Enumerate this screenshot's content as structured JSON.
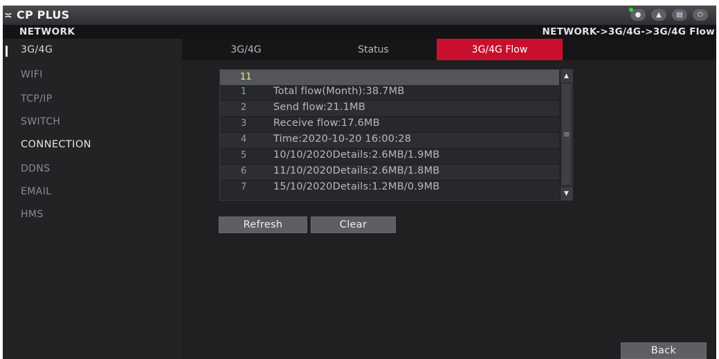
{
  "header": {
    "logo_mark": "≍",
    "logo_text": "CP PLUS",
    "icons": [
      {
        "name": "camera-icon",
        "glyph": "●"
      },
      {
        "name": "user-icon",
        "glyph": "▲"
      },
      {
        "name": "menu-icon",
        "glyph": "▤"
      },
      {
        "name": "power-icon",
        "glyph": "⏻"
      }
    ],
    "status_dot_color": "#38d23c"
  },
  "path": {
    "section": "NETWORK",
    "breadcrumb": "NETWORK->3G/4G->3G/4G Flow"
  },
  "sidebar": {
    "items": [
      {
        "label": "3G/4G",
        "state": "active"
      },
      {
        "label": "WIFI"
      },
      {
        "label": "TCP/IP"
      },
      {
        "label": "SWITCH"
      },
      {
        "label": "CONNECTION"
      },
      {
        "label": "DDNS"
      },
      {
        "label": "EMAIL"
      },
      {
        "label": "HMS"
      }
    ]
  },
  "tabs": [
    {
      "label": "3G/4G"
    },
    {
      "label": "Status"
    },
    {
      "label": "3G/4G Flow",
      "active": true
    }
  ],
  "flow_list": {
    "header": "11",
    "rows": [
      {
        "num": "1",
        "text": "Total flow(Month):38.7MB"
      },
      {
        "num": "2",
        "text": "Send flow:21.1MB"
      },
      {
        "num": "3",
        "text": "Receive flow:17.6MB"
      },
      {
        "num": "4",
        "text": "Time:2020-10-20 16:00:28"
      },
      {
        "num": "5",
        "text": "10/10/2020Details:2.6MB/1.9MB"
      },
      {
        "num": "6",
        "text": "11/10/2020Details:2.6MB/1.8MB"
      },
      {
        "num": "7",
        "text": "15/10/2020Details:1.2MB/0.9MB"
      }
    ],
    "scroll_up": "▲",
    "scroll_down": "▼",
    "scroll_grip": "≡"
  },
  "buttons": {
    "refresh": "Refresh",
    "clear": "Clear",
    "back": "Back"
  },
  "colors": {
    "accent_tab": "#c8102e",
    "header_highlight": "#f2e98a"
  }
}
